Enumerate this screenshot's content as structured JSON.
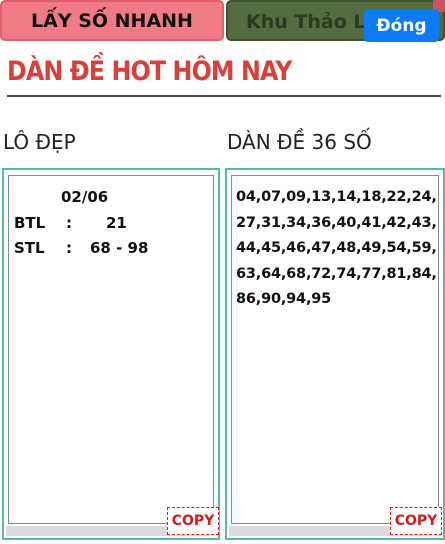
{
  "tabs": {
    "active_label": "LẤY SỐ NHANH",
    "inactive_label": "Khu Thảo Luận"
  },
  "close_label": "Đóng",
  "page_title": "DÀN ĐỀ HOT HÔM NAY",
  "lo_dep": {
    "heading": "LÔ ĐẸP",
    "date": "02/06",
    "rows": [
      {
        "key": "BTL",
        "colon": ":",
        "value": "21"
      },
      {
        "key": "STL",
        "colon": ":",
        "value": "68 - 98"
      }
    ],
    "copy_label": "COPY"
  },
  "dan_de": {
    "heading": "DÀN ĐỀ 36 SỐ",
    "numbers": "04,07,09,13,14,18,22,24,27,31,34,36,40,41,42,43,44,45,46,47,48,49,54,59,63,64,68,72,74,77,81,84,86,90,94,95",
    "copy_label": "COPY"
  },
  "colors": {
    "active_tab": "#f07b87",
    "inactive_tab": "#556b41",
    "close_button": "#0d7bf5",
    "title": "#d8403c",
    "panel_border": "#5cb7ab",
    "copy": "#d21c1c"
  }
}
